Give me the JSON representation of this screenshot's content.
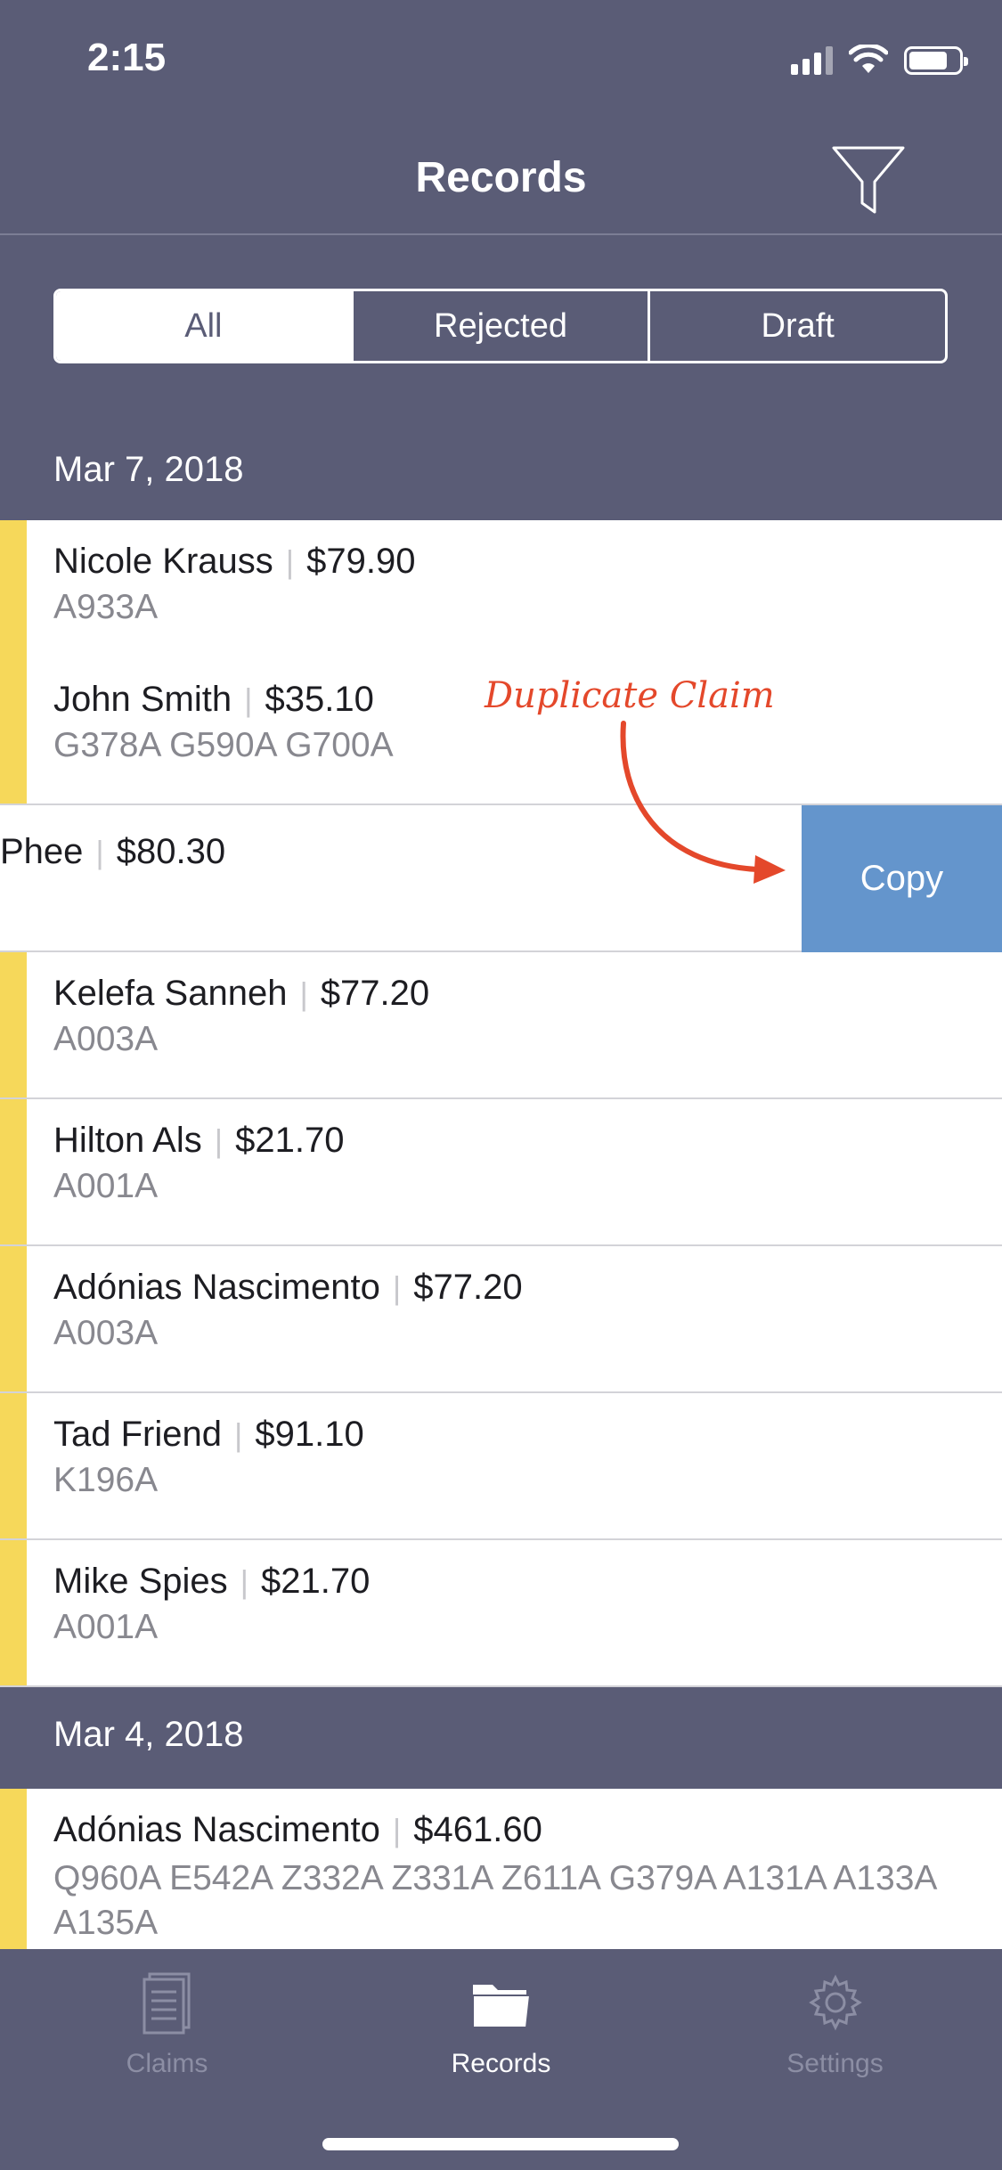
{
  "status": {
    "time": "2:15"
  },
  "nav": {
    "title": "Records"
  },
  "segments": [
    {
      "label": "All",
      "active": true
    },
    {
      "label": "Rejected",
      "active": false
    },
    {
      "label": "Draft",
      "active": false
    }
  ],
  "sections": [
    {
      "date": "Mar 7, 2018",
      "rows": [
        {
          "name": "Nicole Krauss",
          "amount": "$79.90",
          "codes": "A933A"
        },
        {
          "name": "John Smith",
          "amount": "$35.10",
          "codes": "G378A G590A G700A"
        },
        {
          "name": "Phee",
          "amount": "$80.30",
          "codes": ""
        },
        {
          "name": "Kelefa Sanneh",
          "amount": "$77.20",
          "codes": "A003A"
        },
        {
          "name": "Hilton Als",
          "amount": "$21.70",
          "codes": "A001A"
        },
        {
          "name": "Adónias Nascimento",
          "amount": "$77.20",
          "codes": "A003A"
        },
        {
          "name": "Tad Friend",
          "amount": "$91.10",
          "codes": "K196A"
        },
        {
          "name": "Mike Spies",
          "amount": "$21.70",
          "codes": "A001A"
        }
      ]
    },
    {
      "date": "Mar 4, 2018",
      "rows": [
        {
          "name": "Adónias Nascimento",
          "amount": "$461.60",
          "codes": "Q960A E542A Z332A Z331A Z611A G379A A131A A133A A135A"
        }
      ]
    }
  ],
  "swipe_action": {
    "label": "Copy",
    "color": "#6495cc"
  },
  "annotation": {
    "text": "Duplicate Claim",
    "color": "#e4482b"
  },
  "tabs": [
    {
      "label": "Claims",
      "icon": "document-list-icon",
      "active": false
    },
    {
      "label": "Records",
      "icon": "folder-icon",
      "active": true
    },
    {
      "label": "Settings",
      "icon": "gear-icon",
      "active": false
    }
  ],
  "colors": {
    "background": "#5a5c76",
    "row_accent": "#f6d85a"
  }
}
